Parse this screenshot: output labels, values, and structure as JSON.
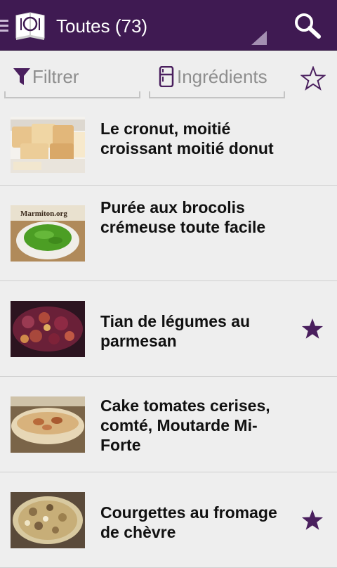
{
  "appbar": {
    "title": "Toutes (73)",
    "logo_icon": "cookbook-logo-icon",
    "menu_icon": "hamburger-menu-icon",
    "search_icon": "search-icon"
  },
  "filterbar": {
    "filter_label": "Filtrer",
    "filter_icon": "funnel-icon",
    "ingredients_label": "Ingrédients",
    "ingredients_icon": "fridge-icon",
    "favorite_icon": "star-outline-icon"
  },
  "recipes": [
    {
      "title": "Le cronut, moitié croissant moitié donut",
      "favorite": false
    },
    {
      "title": "Purée aux brocolis crémeuse toute facile",
      "favorite": false,
      "thumb_text": "Marmiton.org"
    },
    {
      "title": "Tian de légumes au parmesan",
      "favorite": true
    },
    {
      "title": "Cake tomates cerises, comté, Moutarde Mi-Forte",
      "favorite": false
    },
    {
      "title": "Courgettes au fromage de chèvre",
      "favorite": true
    }
  ],
  "colors": {
    "appbar": "#3f1a52",
    "accent": "#4a1f5e",
    "background": "#eeeeee",
    "label_gray": "#8e8e8e"
  }
}
